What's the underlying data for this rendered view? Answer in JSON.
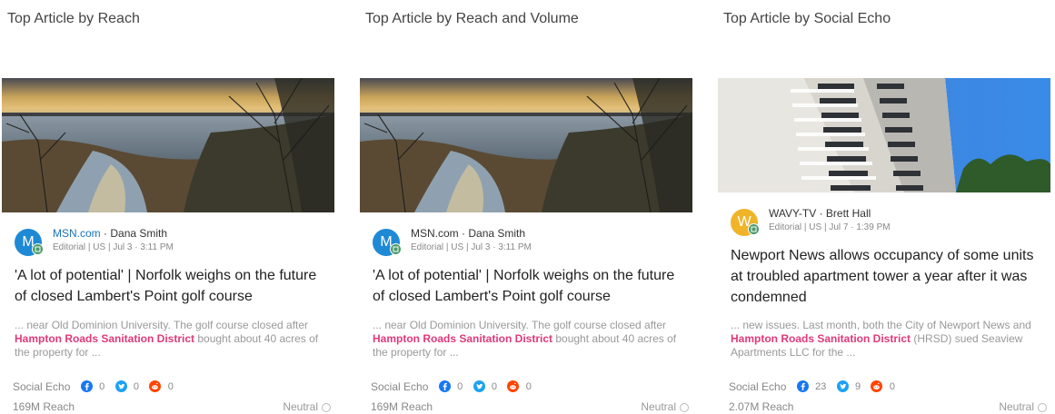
{
  "columns": [
    {
      "title": "Top Article by Reach",
      "image": "lake-sunset-photo",
      "source": {
        "avatar_letter": "M",
        "avatar_color": "#1e8ad6",
        "outlet": "MSN.com",
        "separator": "·",
        "author": "Dana Smith",
        "meta": "Editorial | US | Jul 3 · 3:11 PM"
      },
      "headline": "'A lot of potential' | Norfolk weighs on the future of closed Lambert's Point golf course",
      "snippet": {
        "before": "... near Old Dominion University. The golf course closed after ",
        "highlight": "Hampton Roads Sanitation District",
        "after": " bought about 40 acres of the property for ..."
      },
      "social": {
        "label": "Social Echo",
        "facebook": "0",
        "twitter": "0",
        "reddit": "0"
      },
      "reach": "169M Reach",
      "sentiment": "Neutral"
    },
    {
      "title": "Top Article by Reach and Volume",
      "image": "lake-sunset-photo",
      "source": {
        "avatar_letter": "M",
        "avatar_color": "#1e8ad6",
        "outlet": "MSN.com",
        "separator": "·",
        "author": "Dana Smith",
        "meta": "Editorial | US | Jul 3 · 3:11 PM"
      },
      "headline": "'A lot of potential' | Norfolk weighs on the future of closed Lambert's Point golf course",
      "snippet": {
        "before": "... near Old Dominion University. The golf course closed after ",
        "highlight": "Hampton Roads Sanitation District",
        "after": " bought about 40 acres of the property for ..."
      },
      "social": {
        "label": "Social Echo",
        "facebook": "0",
        "twitter": "0",
        "reddit": "0"
      },
      "reach": "169M Reach",
      "sentiment": "Neutral"
    },
    {
      "title": "Top Article by Social Echo",
      "image": "apartment-tower-photo",
      "source": {
        "avatar_letter": "W",
        "avatar_color": "#f0b429",
        "outlet": "WAVY-TV",
        "separator": "·",
        "author": "Brett Hall",
        "meta": "Editorial | US | Jul 7 · 1:39 PM"
      },
      "headline": "Newport News allows occupancy of some units at troubled apartment tower a year after it was condemned",
      "snippet": {
        "before": "... new issues. Last month, both the City of Newport News and ",
        "highlight": "Hampton Roads Sanitation District",
        "after": " (HRSD) sued Seaview Apartments LLC for the ..."
      },
      "social": {
        "label": "Social Echo",
        "facebook": "23",
        "twitter": "9",
        "reddit": "0"
      },
      "reach": "2.07M Reach",
      "sentiment": "Neutral"
    }
  ],
  "colors": {
    "facebook": "#1877f2",
    "twitter": "#1da1f2",
    "reddit": "#ff4500",
    "highlight": "#e0397a",
    "outlet_link": "#1a73b8"
  }
}
